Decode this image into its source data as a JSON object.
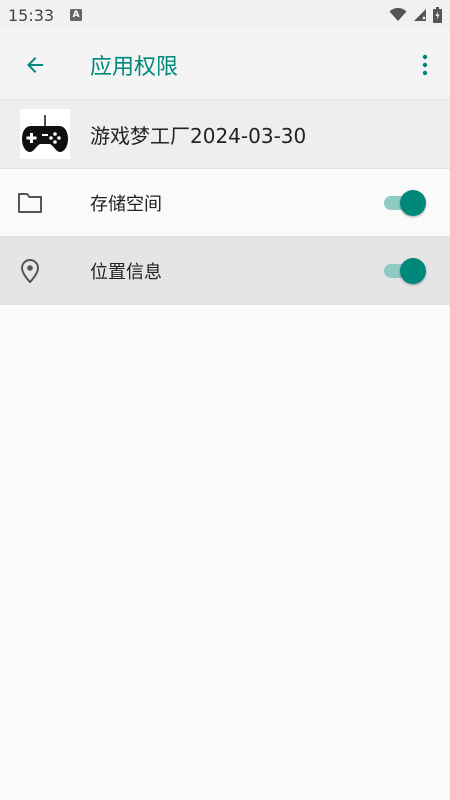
{
  "status_bar": {
    "time": "15:33",
    "notification_badge": "A",
    "icons": [
      "wifi-icon",
      "signal-icon",
      "battery-icon"
    ]
  },
  "app_bar": {
    "back_icon": "arrow-back-icon",
    "title": "应用权限",
    "more_icon": "more-vert-icon"
  },
  "app_header": {
    "icon": "gamepad-icon",
    "name": "游戏梦工厂2024-03-30"
  },
  "permissions": [
    {
      "icon": "folder-icon",
      "label": "存储空间",
      "enabled": true
    },
    {
      "icon": "location-icon",
      "label": "位置信息",
      "enabled": true
    }
  ],
  "colors": {
    "accent": "#00897b",
    "toggle_track": "#8fcbc4",
    "background": "#fafafa"
  }
}
